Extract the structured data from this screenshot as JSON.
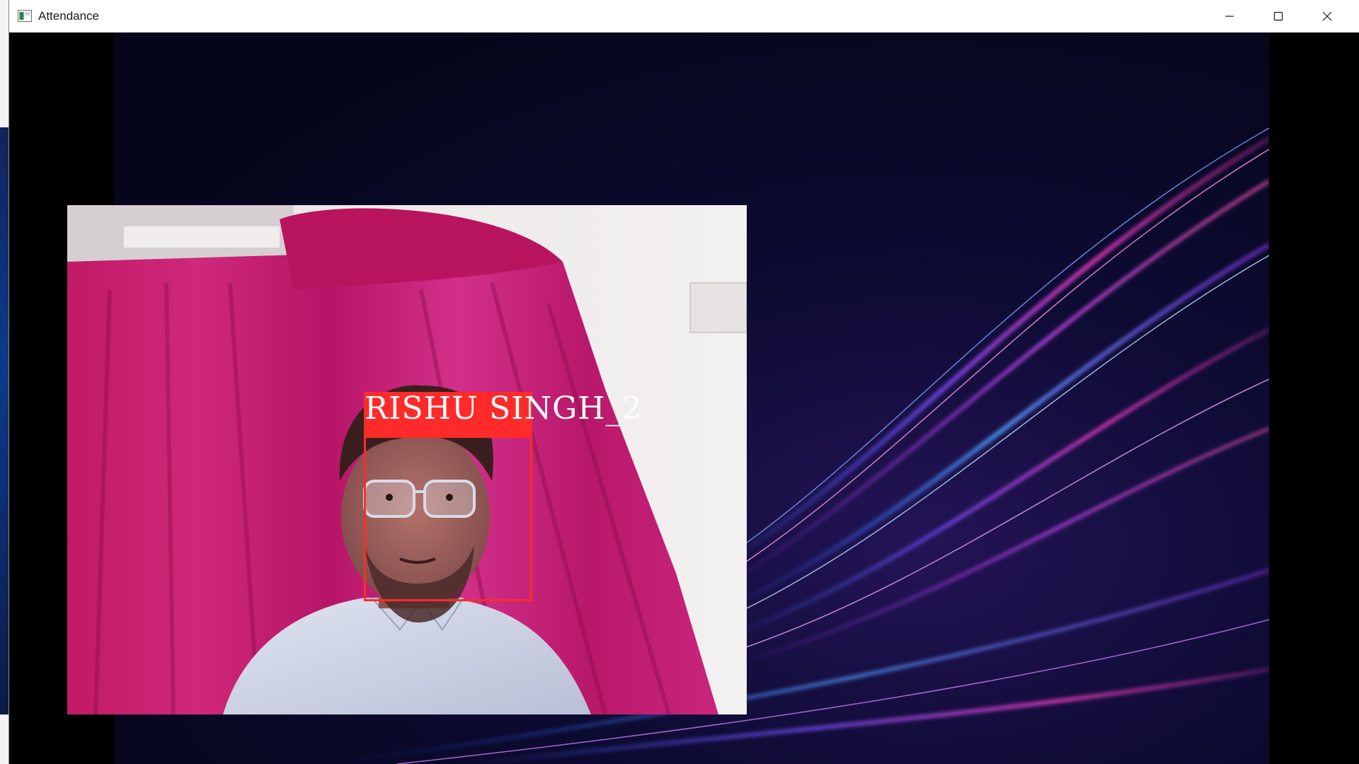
{
  "window": {
    "title": "Attendance",
    "icons": {
      "app": "app-window-icon",
      "minimize": "minimize-icon",
      "maximize": "maximize-icon",
      "close": "close-icon"
    }
  },
  "recognition": {
    "label": "RISHU SINGH_2",
    "box_color": "#ff2b2b",
    "label_text_color": "#ffffff"
  },
  "colors": {
    "background": "#0a0e2a",
    "streak_purple": "#9b3cff",
    "streak_magenta": "#ff3ec8",
    "streak_blue": "#3a6cff"
  }
}
